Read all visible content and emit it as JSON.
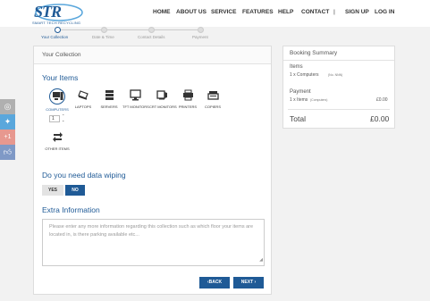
{
  "header": {
    "logo_text": "STR",
    "logo_subtitle": "SMART TECH RECYCLING",
    "nav": [
      {
        "label": "HOME"
      },
      {
        "label": "ABOUT US"
      },
      {
        "label": "SERVICE"
      },
      {
        "label": "FEATURES"
      },
      {
        "label": "HELP"
      },
      {
        "label": "CONTACT"
      },
      {
        "label": "|"
      },
      {
        "label": "SIGN UP"
      },
      {
        "label": "LOG IN"
      }
    ]
  },
  "steps": [
    {
      "label": "Your Collection",
      "active": true
    },
    {
      "label": "Date & Time",
      "active": false
    },
    {
      "label": "Contact Details",
      "active": false
    },
    {
      "label": "Payment",
      "active": false
    }
  ],
  "social": [
    {
      "icon": "camera-icon",
      "color": "#b0b0b0"
    },
    {
      "icon": "twitter-icon",
      "color": "#5aa7dc"
    },
    {
      "icon": "google-plus-icon",
      "color": "#e7988f"
    },
    {
      "icon": "like-icon",
      "color": "#7f99c6"
    }
  ],
  "panel": {
    "title": "Your Collection",
    "items_heading": "Your Items",
    "items": [
      {
        "label": "COMPUTERS",
        "icon": "computer-icon",
        "selected": true
      },
      {
        "label": "LAPTOPS",
        "icon": "laptop-icon",
        "selected": false
      },
      {
        "label": "SERVERS",
        "icon": "server-icon",
        "selected": false
      },
      {
        "label": "TFT MONITORS",
        "icon": "tft-monitor-icon",
        "selected": false
      },
      {
        "label": "CRT MONITORS",
        "icon": "crt-monitor-icon",
        "selected": false
      },
      {
        "label": "PRINTERS",
        "icon": "printer-icon",
        "selected": false
      },
      {
        "label": "COPIERS",
        "icon": "copier-icon",
        "selected": false
      }
    ],
    "quantity": "1",
    "other_items_label": "OTHER ITEMS",
    "wiping_heading": "Do you need data wiping",
    "wiping_yes": "YES",
    "wiping_no": "NO",
    "wiping_selected": "NO",
    "extra_heading": "Extra Information",
    "extra_placeholder": "Please enter any more information regarding this collection such as which floor your items are located in, is there parking available etc...",
    "back_label": "BACK",
    "next_label": "NEXT"
  },
  "summary": {
    "title": "Booking Summary",
    "items_label": "Items",
    "items_line": "1 x Computers",
    "items_note": "(No. NNN)",
    "payment_label": "Payment",
    "payment_line": "1 x Items",
    "payment_note": "(Computers)",
    "payment_amount": "£0.00",
    "total_label": "Total",
    "total_amount": "£0.00"
  },
  "colors": {
    "accent": "#1f5a96",
    "background": "#f2f2f2"
  }
}
